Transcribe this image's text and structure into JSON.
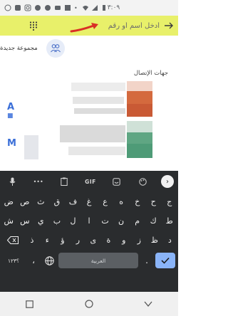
{
  "status_bar": {
    "time": "٣:٠٩",
    "icons": [
      "whatsapp-icon",
      "facebook-icon",
      "instagram-icon",
      "facebook-icon",
      "info-icon",
      "youtube-icon",
      "image-icon",
      "more-dots-icon",
      "wifi-icon",
      "signal-icon",
      "battery-icon"
    ]
  },
  "search": {
    "placeholder": "أدخل أسم أو رقم",
    "value": ""
  },
  "new_group": {
    "label": "مجموعة جديدة"
  },
  "contacts": {
    "section_label": "جهات الإتصال",
    "letters": [
      "A",
      "M"
    ]
  },
  "keyboard": {
    "toolbar": [
      "arrow-right-icon",
      "palette-icon",
      "sticker-icon",
      "GIF",
      "clipboard-icon",
      "more-dots-icon",
      "mic-icon"
    ],
    "gif_label": "GIF",
    "row1": [
      "ض",
      "ص",
      "ث",
      "ق",
      "ف",
      "غ",
      "ع",
      "ه",
      "خ",
      "ح",
      "ج"
    ],
    "row2": [
      "ش",
      "س",
      "ي",
      "ب",
      "ل",
      "ا",
      "ت",
      "ن",
      "م",
      "ك",
      "ط"
    ],
    "row3": [
      "ذ",
      "ء",
      "ؤ",
      "ر",
      "ى",
      "ة",
      "و",
      "ز",
      "ظ",
      "د"
    ],
    "bottom": {
      "symbols": "؟١٢٣",
      "comma": "،",
      "space": "العربية",
      "period": "."
    }
  },
  "colors": {
    "search_bar": "#e8f06a",
    "keyboard_bg": "#2a2c2e",
    "accent_blue": "#8ab4f8",
    "arrow_red": "#d93025"
  }
}
